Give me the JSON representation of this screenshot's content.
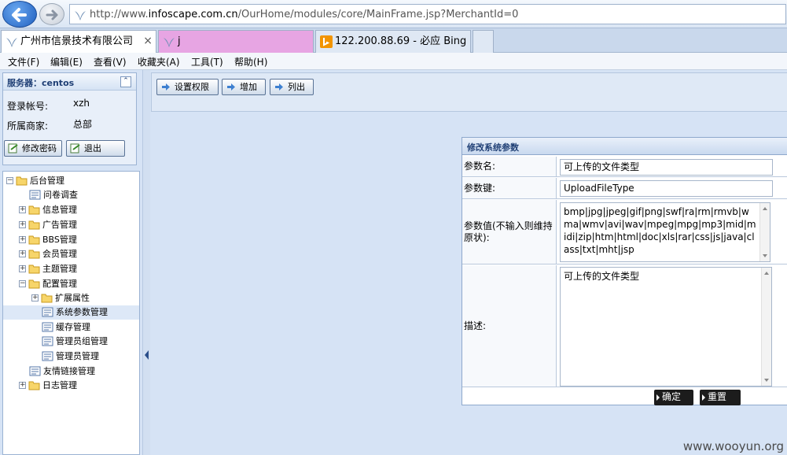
{
  "browser": {
    "url_prefix": "http://www.",
    "url_domain": "infoscape.com.cn",
    "url_path": "/OurHome/modules/core/MainFrame.jsp?MerchantId=0",
    "tabs": [
      {
        "label": "广州市信景技术有限公司",
        "close": "×"
      },
      {
        "label": "j"
      },
      {
        "label": "122.200.88.69 - 必应 Bing"
      }
    ]
  },
  "menu": [
    "文件(F)",
    "编辑(E)",
    "查看(V)",
    "收藏夹(A)",
    "工具(T)",
    "帮助(H)"
  ],
  "userbox": {
    "title": "服务器：centos",
    "collapse": "⌃",
    "login_label": "登录帐号:",
    "login_value": "xzh",
    "merchant_label": "所属商家:",
    "merchant_value": "总部",
    "change_pwd": "修改密码",
    "logout": "退出"
  },
  "tree": {
    "root": "后台管理",
    "items": [
      "问卷调查",
      "信息管理",
      "广告管理",
      "BBS管理",
      "会员管理",
      "主题管理",
      "配置管理",
      "扩展属性",
      "系统参数管理",
      "缓存管理",
      "管理员组管理",
      "管理员管理",
      "友情链接管理",
      "日志管理"
    ]
  },
  "toolbar": {
    "set_perm": "设置权限",
    "add": "增加",
    "list": "列出"
  },
  "form": {
    "title": "修改系统参数",
    "name_label": "参数名:",
    "name_value": "可上传的文件类型",
    "key_label": "参数键:",
    "key_value": "UploadFileType",
    "value_label": "参数值(不输入则维持原状):",
    "value_value": "bmp|jpg|jpeg|gif|png|swf|ra|rm|rmvb|wma|wmv|avi|wav|mpeg|mpg|mp3|mid|midi|zip|htm|html|doc|xls|rar|css|js|java|class|txt|mht|jsp",
    "desc_label": "描述:",
    "desc_value": "可上传的文件类型",
    "confirm": "确定",
    "reset": "重置"
  },
  "watermark": "www.wooyun.org"
}
